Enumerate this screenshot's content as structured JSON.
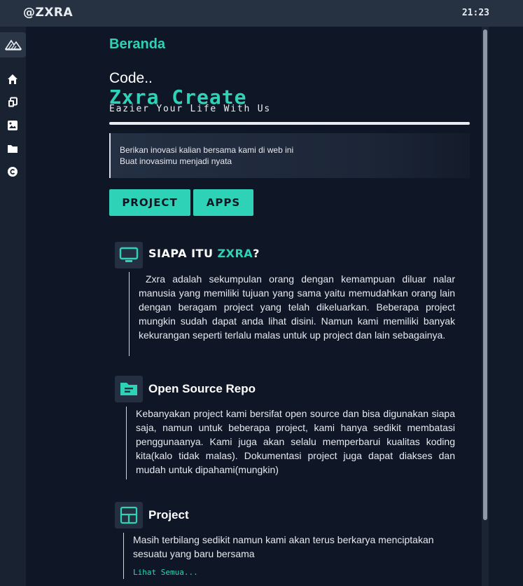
{
  "topbar": {
    "brand": "@ZXRA",
    "clock": "21:23"
  },
  "sidebar": {
    "logo_icon": "zxra-logo-icon",
    "items": [
      {
        "icon": "home-icon"
      },
      {
        "icon": "copy-icon"
      },
      {
        "icon": "image-icon"
      },
      {
        "icon": "folder-icon"
      },
      {
        "icon": "copyright-icon"
      }
    ]
  },
  "main": {
    "page_title": "Beranda",
    "code_label": "Code..",
    "hero_title": "Zxra Create",
    "hero_subtitle": "Eazier Your Life With Us",
    "quote_lines": [
      "Berikan inovasi kalian bersama kami di web ini",
      "Buat inovasimu menjadi nyata"
    ],
    "buttons": {
      "project": "PROJECT",
      "apps": "APPS"
    },
    "sections": {
      "about": {
        "icon": "monitor-icon",
        "heading_prefix": "SIAPA ITU ",
        "heading_accent": "ZXRA",
        "heading_suffix": "?",
        "body": "Zxra adalah sekumpulan orang dengan kemampuan diluar nalar manusia yang memiliki tujuan yang sama yaitu memudahkan orang lain dengan beragam project yang telah dikeluarkan. Beberapa project mungkin sudah dapat anda lihat disini. Namun kami memiliki banyak kekurangan seperti terlalu malas untuk up project dan lain sebagainya."
      },
      "open_source": {
        "icon": "folder-open-icon",
        "heading": "Open Source Repo",
        "body": "Kebanyakan project kami bersifat open source dan bisa digunakan siapa saja, namun untuk beberapa project, kami hanya sedikit membatasi penggunaanya. Kami juga akan selalu memperbarui kualitas koding kita(kalo tidak malas). Dokumentasi project juga dapat diakses dan mudah untuk dipahami(mungkin)"
      },
      "project": {
        "icon": "layout-icon",
        "heading": "Project",
        "body": "Masih terbilang sedikit namun kami akan terus berkarya menciptakan sesuatu yang baru bersama",
        "see_all": "Lihat Semua..."
      }
    }
  },
  "colors": {
    "accent": "#2ed3b7",
    "background": "#0f1626",
    "topbar": "#263241"
  }
}
